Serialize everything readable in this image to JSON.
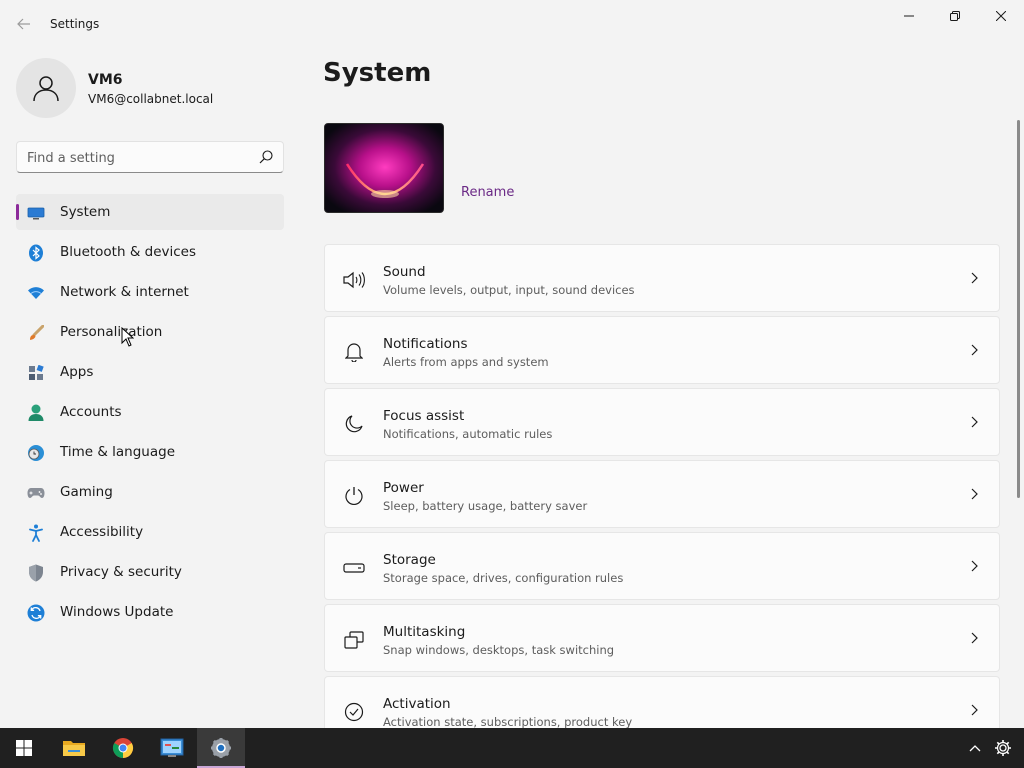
{
  "window": {
    "title": "Settings",
    "controls": [
      "minimize",
      "maximize",
      "close"
    ]
  },
  "account": {
    "name": "VM6",
    "email": "VM6@collabnet.local"
  },
  "search": {
    "placeholder": "Find a setting",
    "value": ""
  },
  "nav": {
    "items": [
      {
        "label": "System",
        "icon": "system-icon",
        "active": true
      },
      {
        "label": "Bluetooth & devices",
        "icon": "bluetooth-icon"
      },
      {
        "label": "Network & internet",
        "icon": "wifi-icon"
      },
      {
        "label": "Personalization",
        "icon": "paintbrush-icon"
      },
      {
        "label": "Apps",
        "icon": "apps-icon"
      },
      {
        "label": "Accounts",
        "icon": "accounts-icon"
      },
      {
        "label": "Time & language",
        "icon": "clock-globe-icon"
      },
      {
        "label": "Gaming",
        "icon": "gamepad-icon"
      },
      {
        "label": "Accessibility",
        "icon": "accessibility-icon"
      },
      {
        "label": "Privacy & security",
        "icon": "shield-icon"
      },
      {
        "label": "Windows Update",
        "icon": "update-icon"
      }
    ]
  },
  "main": {
    "title": "System",
    "rename_label": "Rename",
    "cards": [
      {
        "title": "Sound",
        "subtitle": "Volume levels, output, input, sound devices",
        "icon": "speaker-icon"
      },
      {
        "title": "Notifications",
        "subtitle": "Alerts from apps and system",
        "icon": "bell-icon"
      },
      {
        "title": "Focus assist",
        "subtitle": "Notifications, automatic rules",
        "icon": "moon-icon"
      },
      {
        "title": "Power",
        "subtitle": "Sleep, battery usage, battery saver",
        "icon": "power-icon"
      },
      {
        "title": "Storage",
        "subtitle": "Storage space, drives, configuration rules",
        "icon": "drive-icon"
      },
      {
        "title": "Multitasking",
        "subtitle": "Snap windows, desktops, task switching",
        "icon": "multitasking-icon"
      },
      {
        "title": "Activation",
        "subtitle": "Activation state, subscriptions, product key",
        "icon": "check-circle-icon"
      }
    ]
  },
  "taskbar": {
    "apps": [
      {
        "icon": "windows-start-icon"
      },
      {
        "icon": "file-explorer-icon"
      },
      {
        "icon": "chrome-icon"
      },
      {
        "icon": "control-panel-icon"
      },
      {
        "icon": "settings-icon",
        "active": true
      }
    ],
    "tray": [
      "chevron-up-icon",
      "gear-icon"
    ]
  },
  "colors": {
    "accent": "#8c2a9a",
    "link": "#6b2a86",
    "taskbar_bg": "#202020",
    "window_bg": "#f3f3f3"
  }
}
